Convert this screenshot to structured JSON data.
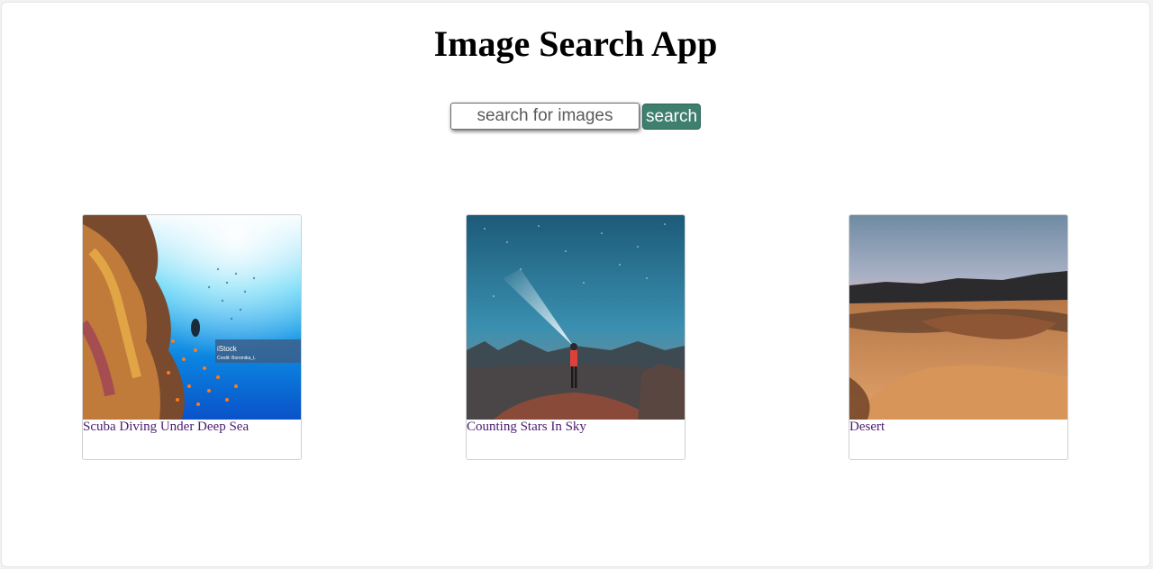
{
  "app": {
    "title": "Image Search App"
  },
  "search": {
    "placeholder": "search for images",
    "value": "",
    "button_label": "search"
  },
  "results": [
    {
      "caption": "Scuba Diving Under Deep Sea",
      "image": "reef-photo",
      "watermark": "iStock",
      "credit": "Credit: Boromika_L"
    },
    {
      "caption": "Counting Stars In Sky",
      "image": "night-sky-photo"
    },
    {
      "caption": "Desert",
      "image": "desert-dunes-photo"
    }
  ],
  "colors": {
    "search_button": "#3f7f6e",
    "link": "#4b1c72"
  }
}
